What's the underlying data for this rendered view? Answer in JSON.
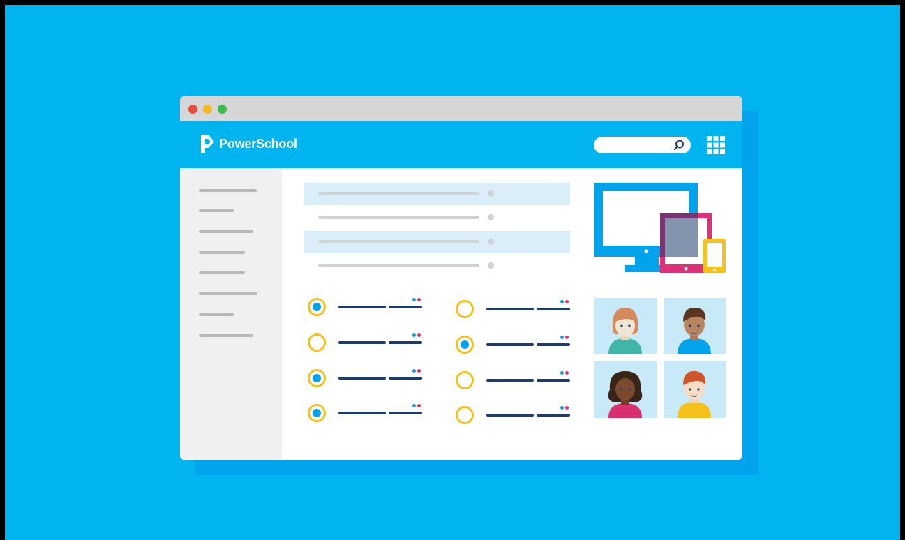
{
  "brand": {
    "name": "PowerSchool"
  },
  "colors": {
    "background": "#00b5ef",
    "window_shadow": "#00a3ec",
    "titlebar": "#d6d6d6",
    "traffic_red": "#e74c3c",
    "traffic_yellow": "#f5b823",
    "traffic_green": "#3ebc4d",
    "radio_ring": "#f5c21b",
    "radio_fill": "#00a3ec",
    "list_line": "#1e3d6e",
    "device_monitor": "#00a3ec",
    "device_tablet": "#e0307a",
    "device_phone": "#f5c21b"
  },
  "icons": {
    "logo": "powerschool-p-logo",
    "search": "search-icon",
    "apps": "grid-icon"
  },
  "options": [
    {
      "selected": true
    },
    {
      "selected": false
    },
    {
      "selected": true
    },
    {
      "selected": true
    },
    {
      "selected": false
    },
    {
      "selected": true
    },
    {
      "selected": false
    },
    {
      "selected": false
    }
  ]
}
